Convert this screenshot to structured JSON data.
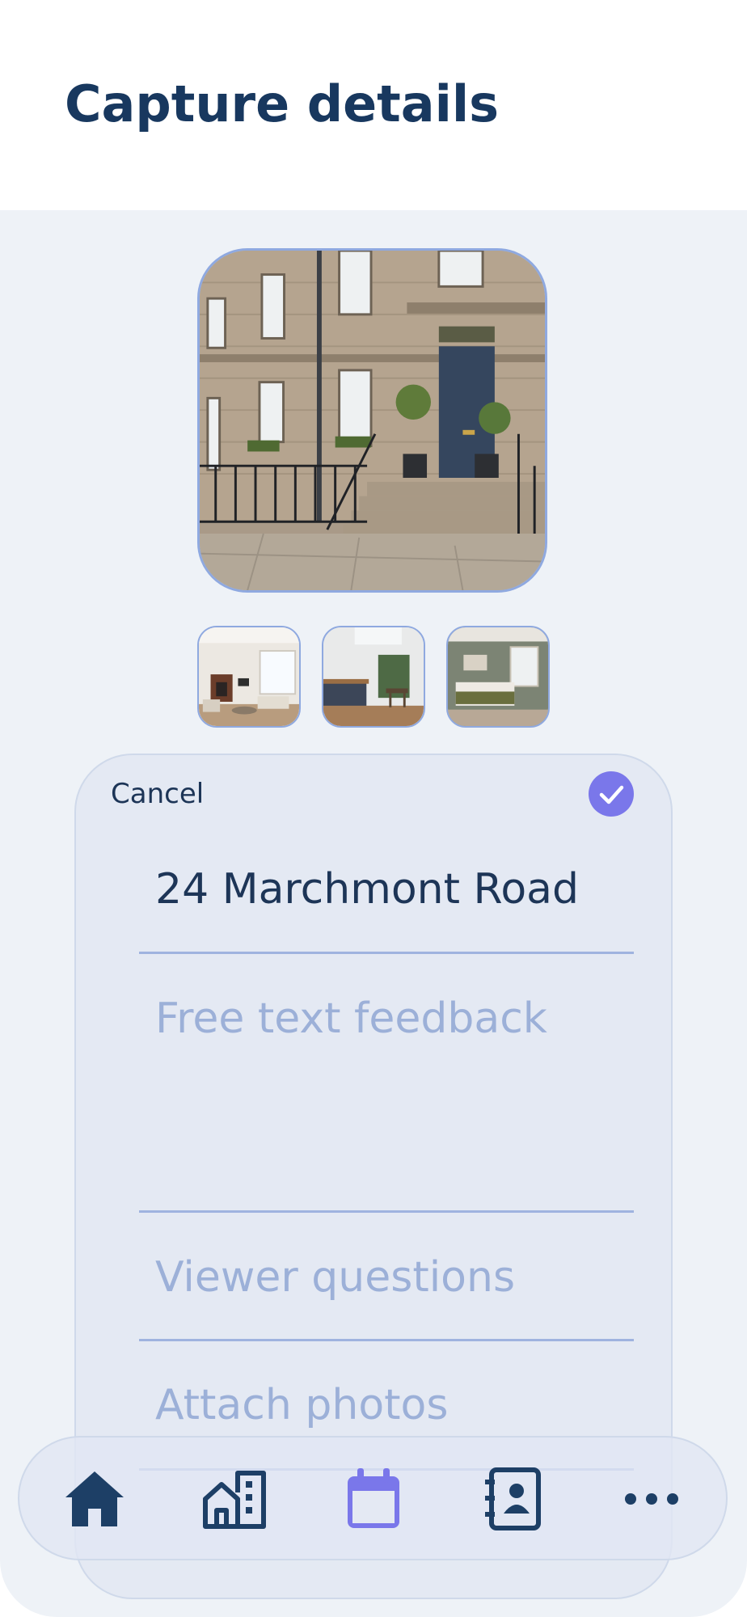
{
  "header": {
    "title": "Capture details"
  },
  "photos": {
    "main": "building-exterior-photo",
    "thumbnails": [
      "living-room-photo",
      "kitchen-photo",
      "bedroom-photo"
    ]
  },
  "form": {
    "cancel_label": "Cancel",
    "confirm_icon": "check-icon",
    "address_value": "24 Marchmont Road",
    "feedback_placeholder": "Free text feedback",
    "questions_placeholder": "Viewer questions",
    "attach_placeholder": "Attach photos"
  },
  "nav": {
    "items": [
      "home-icon",
      "property-icon",
      "calendar-icon",
      "contacts-icon",
      "more-icon"
    ],
    "active": "calendar-icon"
  },
  "colors": {
    "title": "#18385f",
    "accent": "#7a77ea",
    "nav_icon": "#1d3f66",
    "nav_active": "#7a77ea",
    "placeholder": "#9cb0d8"
  }
}
